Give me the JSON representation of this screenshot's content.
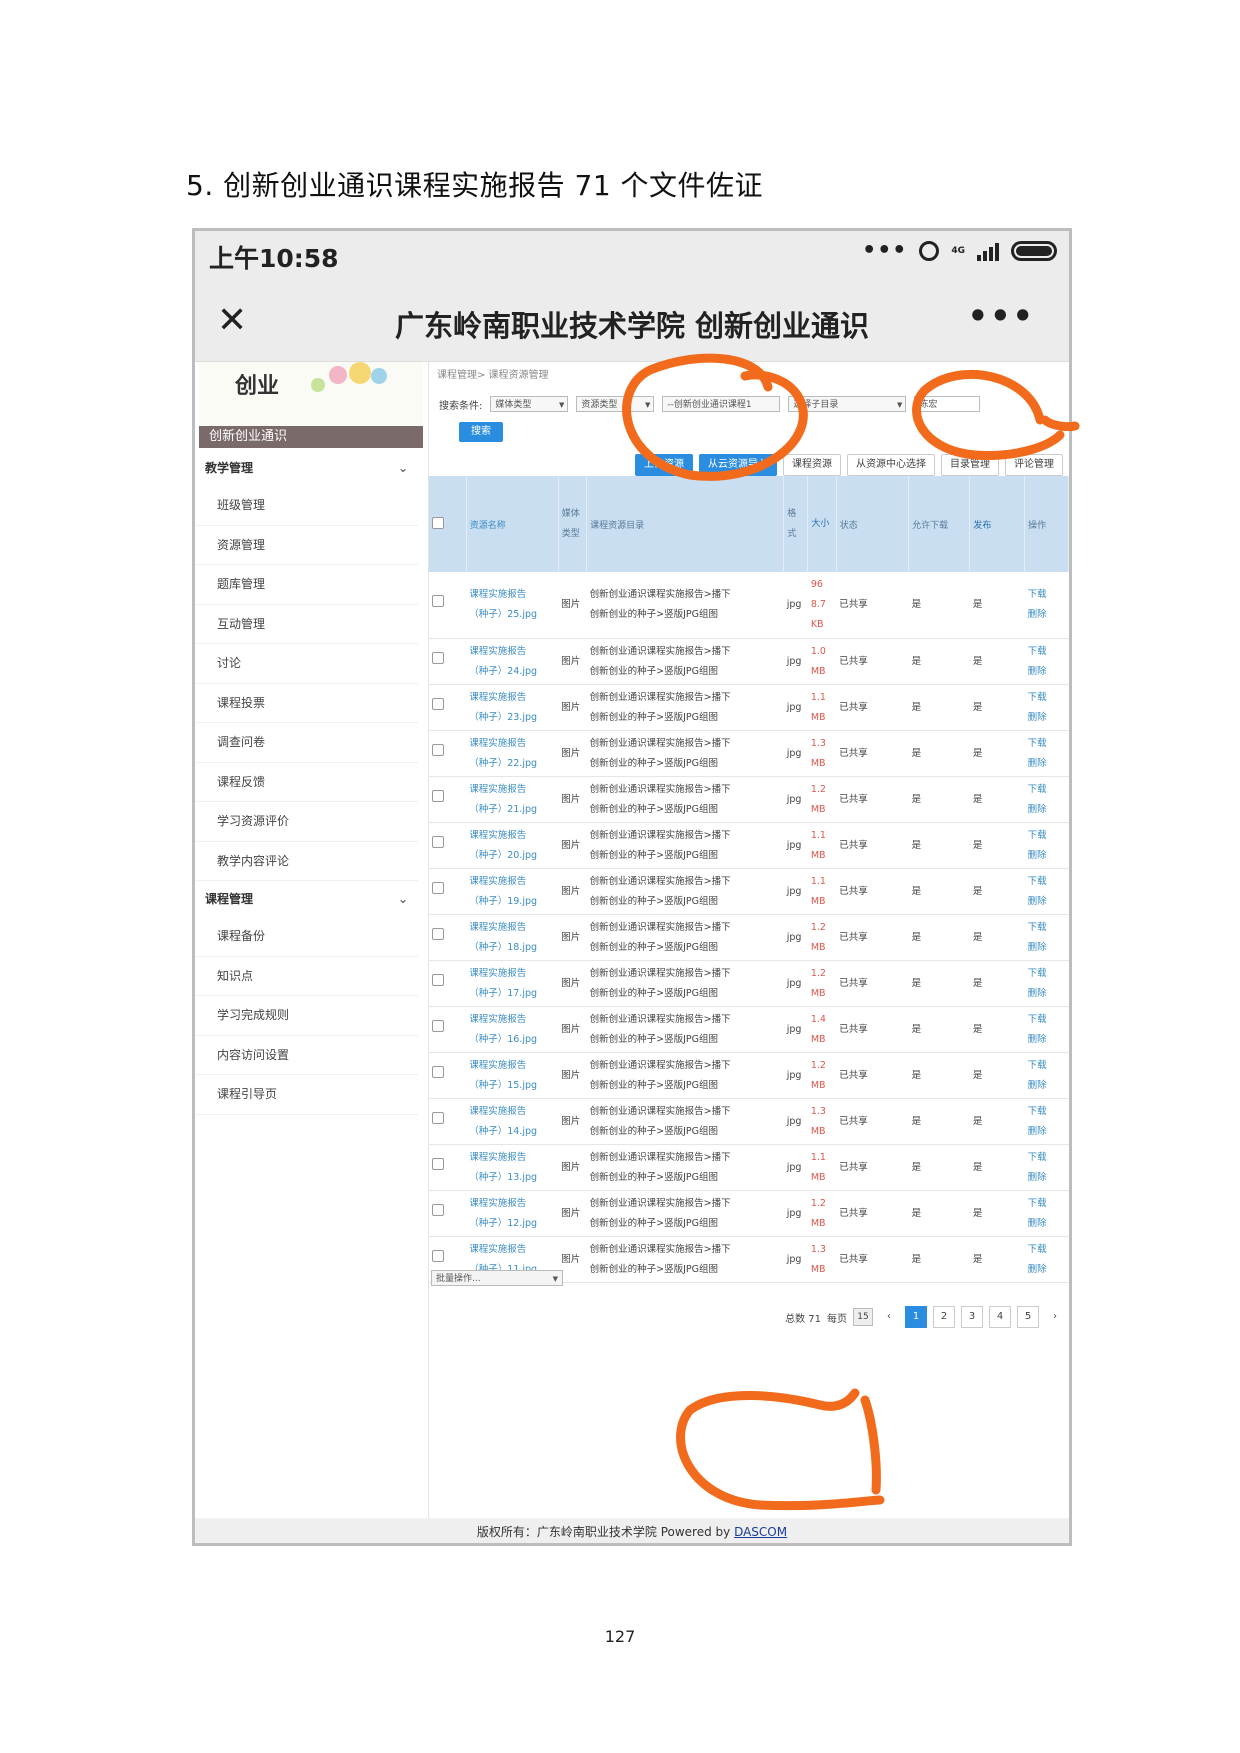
{
  "doc": {
    "heading": "5. 创新创业通识课程实施报告 71 个文件佐证",
    "page_number": "127"
  },
  "phone": {
    "time": "上午10:58",
    "network": "4G",
    "app_title": "广东岭南职业技术学院 创新创业通识"
  },
  "sidebar": {
    "banner_title": "创新创业通识",
    "logo_text": "创业",
    "groups": [
      {
        "label": "教学管理",
        "items": [
          "班级管理",
          "资源管理",
          "题库管理",
          "互动管理",
          "讨论",
          "课程投票",
          "调查问卷",
          "课程反馈",
          "学习资源评价",
          "教学内容评论"
        ]
      },
      {
        "label": "课程管理",
        "items": [
          "课程备份",
          "知识点",
          "学习完成规则",
          "内容访问设置",
          "课程引导页"
        ]
      }
    ]
  },
  "content": {
    "breadcrumb": "课程管理> 课程资源管理",
    "search_label": "搜索条件:",
    "filter_media": "媒体类型",
    "filter_resource": "资源类型",
    "filter_course": "--创新创业通识课程1",
    "filter_dir": "选择子目录",
    "search_value": "陈宏",
    "search_button": "搜索",
    "toolbar": [
      "上传资源",
      "从云资源导入",
      "课程资源",
      "从资源中心选择",
      "目录管理",
      "评论管理"
    ],
    "columns": [
      "资源名称",
      "媒体类型",
      "课程资源目录",
      "格式",
      "大小",
      "状态",
      "允许下载",
      "发布",
      "操作"
    ],
    "rows": [
      {
        "name1": "课程实施报告",
        "name2": "（种子）25.jpg",
        "media": "图片",
        "dir1": "创新创业通识课程实施报告>播下",
        "dir2": "创新创业的种子>竖版JPG组图",
        "fmt": "jpg",
        "size": "96 8.7 KB",
        "status": "已共享",
        "allow": "是",
        "pub": "是",
        "op1": "下载",
        "op2": "删除"
      },
      {
        "name1": "课程实施报告",
        "name2": "（种子）24.jpg",
        "media": "图片",
        "dir1": "创新创业通识课程实施报告>播下",
        "dir2": "创新创业的种子>竖版JPG组图",
        "fmt": "jpg",
        "size": "1.0 MB",
        "status": "已共享",
        "allow": "是",
        "pub": "是",
        "op1": "下载",
        "op2": "删除"
      },
      {
        "name1": "课程实施报告",
        "name2": "（种子）23.jpg",
        "media": "图片",
        "dir1": "创新创业通识课程实施报告>播下",
        "dir2": "创新创业的种子>竖版JPG组图",
        "fmt": "jpg",
        "size": "1.1 MB",
        "status": "已共享",
        "allow": "是",
        "pub": "是",
        "op1": "下载",
        "op2": "删除"
      },
      {
        "name1": "课程实施报告",
        "name2": "（种子）22.jpg",
        "media": "图片",
        "dir1": "创新创业通识课程实施报告>播下",
        "dir2": "创新创业的种子>竖版JPG组图",
        "fmt": "jpg",
        "size": "1.3 MB",
        "status": "已共享",
        "allow": "是",
        "pub": "是",
        "op1": "下载",
        "op2": "删除"
      },
      {
        "name1": "课程实施报告",
        "name2": "（种子）21.jpg",
        "media": "图片",
        "dir1": "创新创业通识课程实施报告>播下",
        "dir2": "创新创业的种子>竖版JPG组图",
        "fmt": "jpg",
        "size": "1.2 MB",
        "status": "已共享",
        "allow": "是",
        "pub": "是",
        "op1": "下载",
        "op2": "删除"
      },
      {
        "name1": "课程实施报告",
        "name2": "（种子）20.jpg",
        "media": "图片",
        "dir1": "创新创业通识课程实施报告>播下",
        "dir2": "创新创业的种子>竖版JPG组图",
        "fmt": "jpg",
        "size": "1.1 MB",
        "status": "已共享",
        "allow": "是",
        "pub": "是",
        "op1": "下载",
        "op2": "删除"
      },
      {
        "name1": "课程实施报告",
        "name2": "（种子）19.jpg",
        "media": "图片",
        "dir1": "创新创业通识课程实施报告>播下",
        "dir2": "创新创业的种子>竖版JPG组图",
        "fmt": "jpg",
        "size": "1.1 MB",
        "status": "已共享",
        "allow": "是",
        "pub": "是",
        "op1": "下载",
        "op2": "删除"
      },
      {
        "name1": "课程实施报告",
        "name2": "（种子）18.jpg",
        "media": "图片",
        "dir1": "创新创业通识课程实施报告>播下",
        "dir2": "创新创业的种子>竖版JPG组图",
        "fmt": "jpg",
        "size": "1.2 MB",
        "status": "已共享",
        "allow": "是",
        "pub": "是",
        "op1": "下载",
        "op2": "删除"
      },
      {
        "name1": "课程实施报告",
        "name2": "（种子）17.jpg",
        "media": "图片",
        "dir1": "创新创业通识课程实施报告>播下",
        "dir2": "创新创业的种子>竖版JPG组图",
        "fmt": "jpg",
        "size": "1.2 MB",
        "status": "已共享",
        "allow": "是",
        "pub": "是",
        "op1": "下载",
        "op2": "删除"
      },
      {
        "name1": "课程实施报告",
        "name2": "（种子）16.jpg",
        "media": "图片",
        "dir1": "创新创业通识课程实施报告>播下",
        "dir2": "创新创业的种子>竖版JPG组图",
        "fmt": "jpg",
        "size": "1.4 MB",
        "status": "已共享",
        "allow": "是",
        "pub": "是",
        "op1": "下载",
        "op2": "删除"
      },
      {
        "name1": "课程实施报告",
        "name2": "（种子）15.jpg",
        "media": "图片",
        "dir1": "创新创业通识课程实施报告>播下",
        "dir2": "创新创业的种子>竖版JPG组图",
        "fmt": "jpg",
        "size": "1.2 MB",
        "status": "已共享",
        "allow": "是",
        "pub": "是",
        "op1": "下载",
        "op2": "删除"
      },
      {
        "name1": "课程实施报告",
        "name2": "（种子）14.jpg",
        "media": "图片",
        "dir1": "创新创业通识课程实施报告>播下",
        "dir2": "创新创业的种子>竖版JPG组图",
        "fmt": "jpg",
        "size": "1.3 MB",
        "status": "已共享",
        "allow": "是",
        "pub": "是",
        "op1": "下载",
        "op2": "删除"
      },
      {
        "name1": "课程实施报告",
        "name2": "（种子）13.jpg",
        "media": "图片",
        "dir1": "创新创业通识课程实施报告>播下",
        "dir2": "创新创业的种子>竖版JPG组图",
        "fmt": "jpg",
        "size": "1.1 MB",
        "status": "已共享",
        "allow": "是",
        "pub": "是",
        "op1": "下载",
        "op2": "删除"
      },
      {
        "name1": "课程实施报告",
        "name2": "（种子）12.jpg",
        "media": "图片",
        "dir1": "创新创业通识课程实施报告>播下",
        "dir2": "创新创业的种子>竖版JPG组图",
        "fmt": "jpg",
        "size": "1.2 MB",
        "status": "已共享",
        "allow": "是",
        "pub": "是",
        "op1": "下载",
        "op2": "删除"
      },
      {
        "name1": "课程实施报告",
        "name2": "（种子）11.jpg",
        "media": "图片",
        "dir1": "创新创业通识课程实施报告>播下",
        "dir2": "创新创业的种子>竖版JPG组图",
        "fmt": "jpg",
        "size": "1.3 MB",
        "status": "已共享",
        "allow": "是",
        "pub": "是",
        "op1": "下载",
        "op2": "删除"
      }
    ],
    "batch_label": "批量操作...",
    "pager": {
      "total": "总数 71",
      "per_page_label": "每页",
      "per_page": "15",
      "prev": "‹",
      "next": "›",
      "pages": [
        "1",
        "2",
        "3",
        "4",
        "5"
      ],
      "current": "1"
    }
  },
  "footer": {
    "text": "版权所有：广东岭南职业技术学院 Powered by ",
    "link": "DASCOM"
  },
  "colors": {
    "accent": "#2b8de0",
    "header_bg": "#c9def1",
    "size_red": "#e1564c",
    "marker_orange": "#f26b1d"
  }
}
